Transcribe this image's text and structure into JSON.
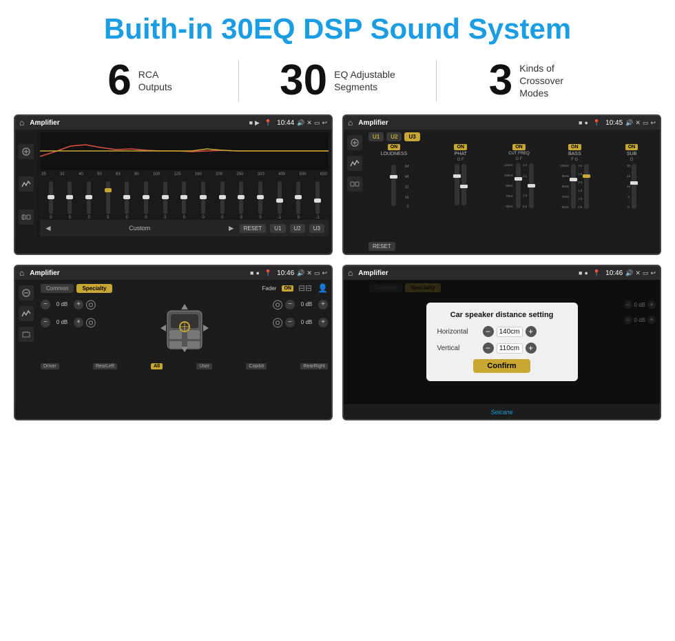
{
  "header": {
    "title": "Buith-in 30EQ DSP Sound System"
  },
  "stats": [
    {
      "number": "6",
      "label": "RCA\nOutputs"
    },
    {
      "number": "30",
      "label": "EQ Adjustable\nSegments"
    },
    {
      "number": "3",
      "label": "Kinds of\nCrossover Modes"
    }
  ],
  "screens": {
    "eq": {
      "title": "Amplifier",
      "time": "10:44",
      "freqs": [
        "25",
        "32",
        "40",
        "50",
        "63",
        "80",
        "100",
        "125",
        "160",
        "200",
        "250",
        "320",
        "400",
        "500",
        "630"
      ],
      "values": [
        "0",
        "0",
        "0",
        "5",
        "0",
        "0",
        "0",
        "0",
        "0",
        "0",
        "0",
        "0",
        "-1",
        "0",
        "-1"
      ],
      "controls": {
        "prev": "◄",
        "label": "Custom",
        "next": "►",
        "reset": "RESET",
        "u1": "U1",
        "u2": "U2",
        "u3": "U3"
      }
    },
    "crossover": {
      "title": "Amplifier",
      "time": "10:45",
      "presets": [
        "U1",
        "U2",
        "U3"
      ],
      "channels": [
        {
          "name": "LOUDNESS",
          "toggle": "ON",
          "gf": ""
        },
        {
          "name": "PHAT",
          "toggle": "ON",
          "gf": "G F"
        },
        {
          "name": "CUT FREQ",
          "toggle": "ON",
          "gf": "G F"
        },
        {
          "name": "BASS",
          "toggle": "ON",
          "gf": "F G"
        },
        {
          "name": "SUB",
          "toggle": "ON",
          "gf": "G"
        }
      ],
      "reset": "RESET"
    },
    "fader": {
      "title": "Amplifier",
      "time": "10:46",
      "tabs": [
        "Common",
        "Specialty"
      ],
      "activeTab": 1,
      "faderLabel": "Fader",
      "onLabel": "ON",
      "channels": [
        {
          "value": "0 dB"
        },
        {
          "value": "0 dB"
        },
        {
          "value": "0 dB"
        },
        {
          "value": "0 dB"
        }
      ],
      "positions": [
        "Driver",
        "RearLeft",
        "All",
        "User",
        "Copilot",
        "RearRight"
      ]
    },
    "dialog": {
      "title": "Amplifier",
      "time": "10:46",
      "dialogTitle": "Car speaker distance setting",
      "horizontal": {
        "label": "Horizontal",
        "value": "140cm"
      },
      "vertical": {
        "label": "Vertical",
        "value": "110cm"
      },
      "confirmLabel": "Confirm",
      "rightValues": [
        {
          "value": "0 dB"
        },
        {
          "value": "0 dB"
        }
      ]
    }
  },
  "watermark": "Seicane"
}
